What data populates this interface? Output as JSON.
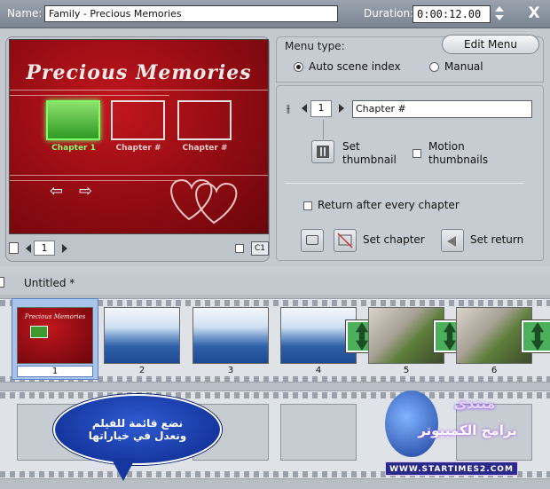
{
  "header": {
    "name_label": "Name:",
    "name_value": "Family - Precious Memories",
    "duration_label": "Duration:",
    "duration_value": "0:00:12.00",
    "close_label": "X"
  },
  "preview": {
    "menu_title": "Precious Memories",
    "chapters": [
      {
        "label": "Chapter 1",
        "selected": true
      },
      {
        "label": "Chapter #",
        "selected": false
      },
      {
        "label": "Chapter #",
        "selected": false
      }
    ],
    "page_number": "1",
    "c1_label": "C1"
  },
  "menu_settings": {
    "menu_type_label": "Menu type:",
    "edit_menu_label": "Edit Menu",
    "auto_scene_label": "Auto scene index",
    "manual_label": "Manual",
    "selected_type": "auto",
    "chapter_number": "1",
    "chapter_name": "Chapter #",
    "set_thumbnail_label": "Set\nthumbnail",
    "motion_thumbnails_label": "Motion\nthumbnails",
    "return_after_label": "Return after every chapter",
    "set_chapter_label": "Set chapter",
    "set_return_label": "Set return"
  },
  "timeline": {
    "project_tab": "Untitled *",
    "clips": [
      {
        "num": "1",
        "kind": "menu"
      },
      {
        "num": "2",
        "kind": "ocean"
      },
      {
        "num": "3",
        "kind": "ocean"
      },
      {
        "num": "4",
        "kind": "ocean"
      },
      {
        "num": "5",
        "kind": "photo"
      },
      {
        "num": "6",
        "kind": "photo"
      }
    ]
  },
  "annotation": {
    "line1": "نضع قائمة للفيلم",
    "line2": "ونعدل في خياراتها"
  },
  "watermark": {
    "line1": "منتدى",
    "line2": "برامج الكمبيوتر",
    "site": "WWW.STARTIMES2.COM"
  },
  "colors": {
    "menu_background": "#9a0d14",
    "selected_chapter": "#7dff6a",
    "bubble": "#1637a0"
  }
}
